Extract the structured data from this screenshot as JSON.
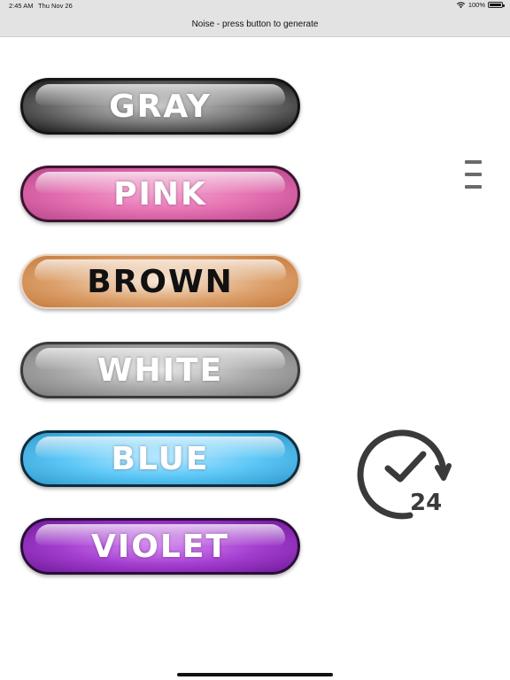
{
  "status_bar": {
    "time": "2:45 AM",
    "date": "Thu Nov 26",
    "battery": "100%",
    "icons": [
      "wifi-icon",
      "battery-icon"
    ]
  },
  "nav": {
    "title": "Noise - press button to generate"
  },
  "buttons": [
    {
      "label": "GRAY",
      "color": "#1a1a1a"
    },
    {
      "label": "PINK",
      "color": "#e46fb0"
    },
    {
      "label": "BROWN",
      "color": "#c5793b"
    },
    {
      "label": "WHITE",
      "color": "#a9a9a9"
    },
    {
      "label": "BLUE",
      "color": "#5cc7f6"
    },
    {
      "label": "VIOLET",
      "color": "#a53ed0"
    }
  ],
  "side_controls": {
    "menu_icon": "hamburger-menu-icon",
    "timer_icon": "clock-24h-icon",
    "timer_label": "24"
  }
}
